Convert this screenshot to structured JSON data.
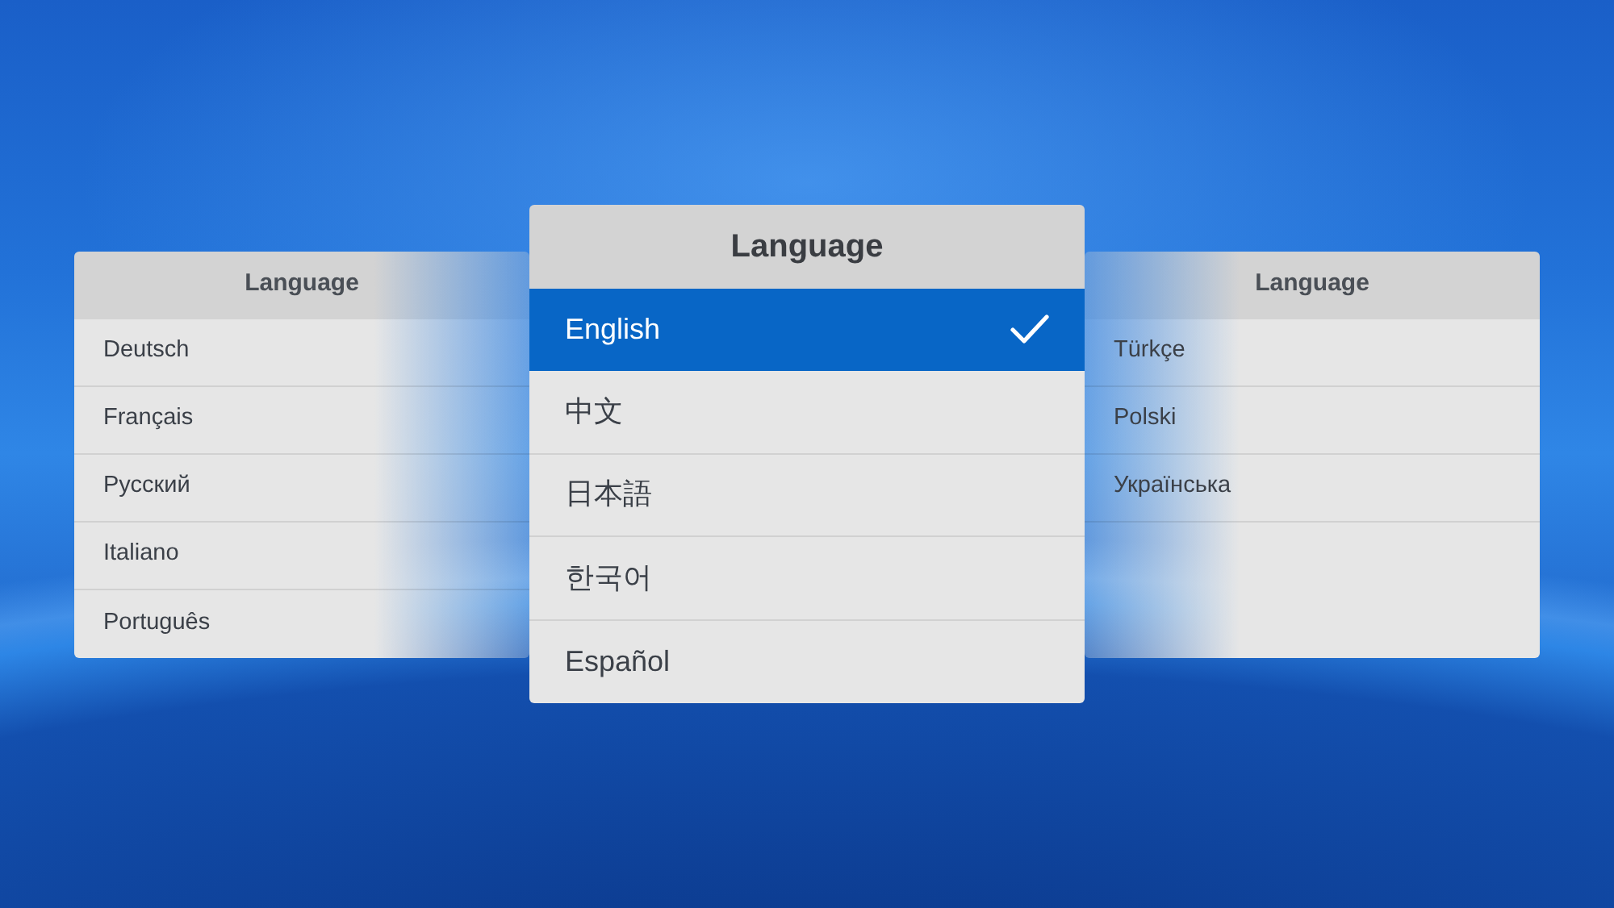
{
  "panels": [
    {
      "title": "Language",
      "focused": false,
      "items": [
        {
          "label": "Deutsch",
          "selected": false
        },
        {
          "label": "Français",
          "selected": false
        },
        {
          "label": "Русский",
          "selected": false
        },
        {
          "label": "Italiano",
          "selected": false
        },
        {
          "label": "Português",
          "selected": false
        }
      ]
    },
    {
      "title": "Language",
      "focused": true,
      "items": [
        {
          "label": "English",
          "selected": true
        },
        {
          "label": "中文",
          "selected": false
        },
        {
          "label": "日本語",
          "selected": false
        },
        {
          "label": "한국어",
          "selected": false
        },
        {
          "label": "Español",
          "selected": false
        }
      ]
    },
    {
      "title": "Language",
      "focused": false,
      "items": [
        {
          "label": "Türkçe",
          "selected": false
        },
        {
          "label": "Polski",
          "selected": false
        },
        {
          "label": "Українська",
          "selected": false
        }
      ]
    }
  ]
}
